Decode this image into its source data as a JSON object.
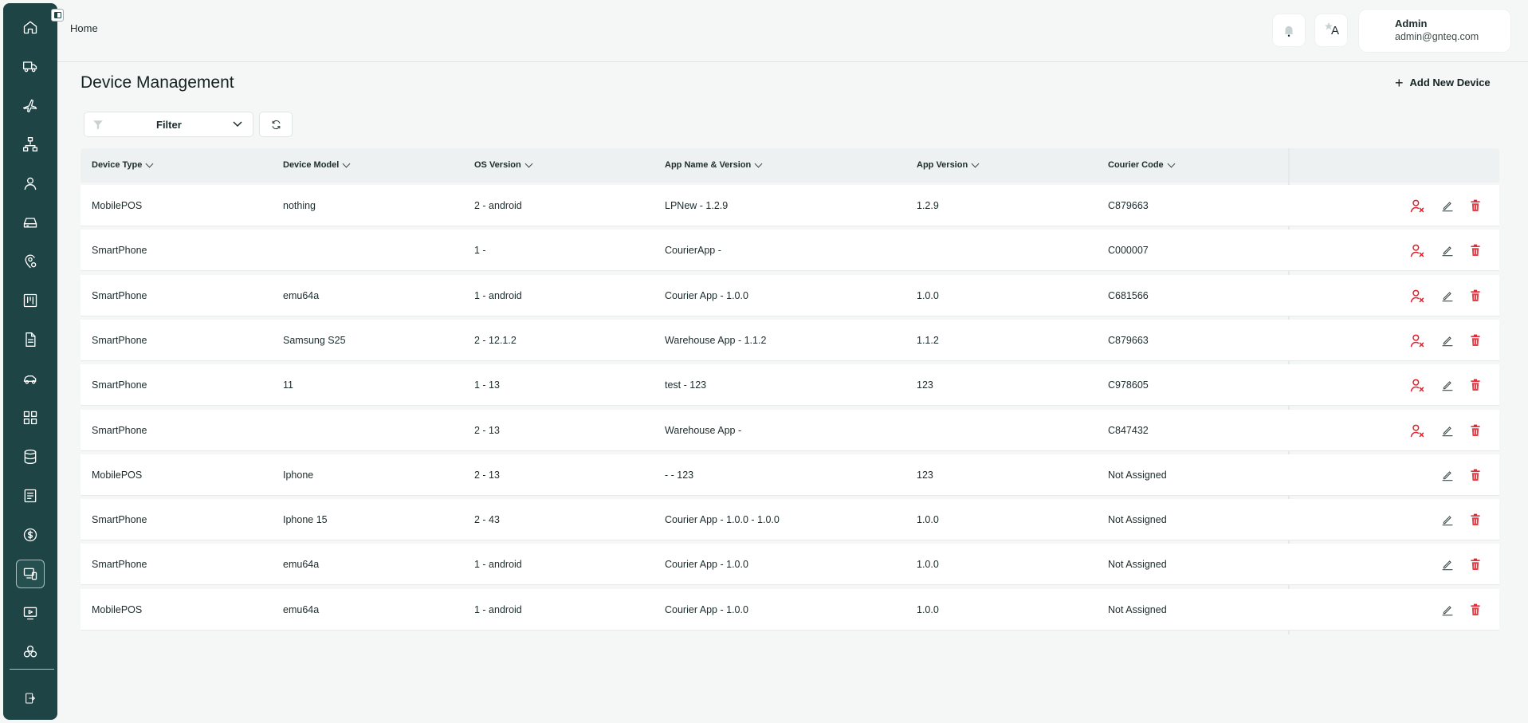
{
  "header": {
    "breadcrumb": "Home",
    "user": {
      "name": "Admin",
      "email": "admin@gnteq.com"
    },
    "language_icon_letter": "A"
  },
  "sidebar": {
    "items": [
      {
        "icon": "home-icon"
      },
      {
        "icon": "truck-icon"
      },
      {
        "icon": "plane-icon"
      },
      {
        "icon": "hierarchy-icon"
      },
      {
        "icon": "user-icon"
      },
      {
        "icon": "hard-drive-icon"
      },
      {
        "icon": "location-settings-icon"
      },
      {
        "icon": "kanban-board-icon"
      },
      {
        "icon": "document-icon"
      },
      {
        "icon": "car-icon"
      },
      {
        "icon": "dashboard-grid-icon"
      },
      {
        "icon": "database-icon"
      },
      {
        "icon": "report-icon"
      },
      {
        "icon": "dollar-icon"
      },
      {
        "icon": "devices-icon",
        "active": true
      },
      {
        "icon": "monitor-play-icon"
      },
      {
        "icon": "clover-icon"
      }
    ],
    "logout_icon": "logout-icon"
  },
  "page": {
    "title": "Device Management",
    "add_button_label": "Add New Device",
    "filter_label": "Filter"
  },
  "table": {
    "columns": [
      "Device Type",
      "Device Model",
      "OS Version",
      "App Name & Version",
      "App Version",
      "Courier Code"
    ],
    "rows": [
      {
        "cells": [
          "MobilePOS",
          "nothing",
          "2 - android",
          "LPNew - 1.2.9",
          "1.2.9",
          "C879663"
        ],
        "assigned": true
      },
      {
        "cells": [
          "SmartPhone",
          "",
          "1 -",
          "CourierApp -",
          "",
          "C000007"
        ],
        "assigned": true
      },
      {
        "cells": [
          "SmartPhone",
          "emu64a",
          "1 - android",
          "Courier App - 1.0.0",
          "1.0.0",
          "C681566"
        ],
        "assigned": true
      },
      {
        "cells": [
          "SmartPhone",
          "Samsung S25",
          "2 - 12.1.2",
          "Warehouse App - 1.1.2",
          "1.1.2",
          "C879663"
        ],
        "assigned": true
      },
      {
        "cells": [
          "SmartPhone",
          "11",
          "1 - 13",
          "test - 123",
          "123",
          "C978605"
        ],
        "assigned": true
      },
      {
        "cells": [
          "SmartPhone",
          "",
          "2 - 13",
          "Warehouse App -",
          "",
          "C847432"
        ],
        "assigned": true
      },
      {
        "cells": [
          "MobilePOS",
          "Iphone",
          "2 - 13",
          "- - 123",
          "123",
          "Not Assigned"
        ],
        "assigned": false
      },
      {
        "cells": [
          "SmartPhone",
          "Iphone 15",
          "2 - 43",
          "Courier App - 1.0.0 - 1.0.0",
          "1.0.0",
          "Not Assigned"
        ],
        "assigned": false
      },
      {
        "cells": [
          "SmartPhone",
          "emu64a",
          "1 - android",
          "Courier App - 1.0.0",
          "1.0.0",
          "Not Assigned"
        ],
        "assigned": false
      },
      {
        "cells": [
          "MobilePOS",
          "emu64a",
          "1 - android",
          "Courier App - 1.0.0",
          "1.0.0",
          "Not Assigned"
        ],
        "assigned": false
      }
    ]
  },
  "colors": {
    "sidebar_bg": "#1e4445",
    "unassign_icon": "#e0202a",
    "delete_icon": "#e0202a"
  }
}
